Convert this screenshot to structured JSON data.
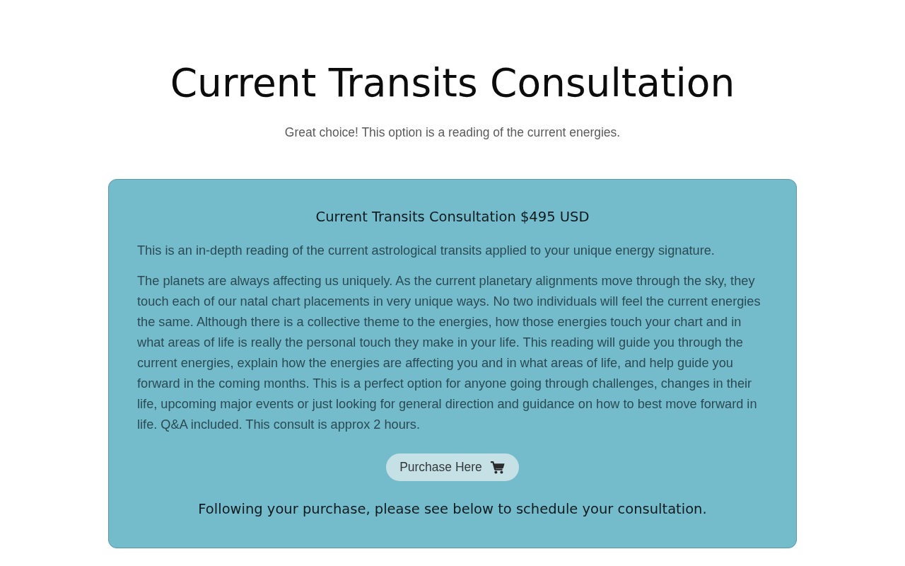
{
  "page": {
    "title": "Current Transits Consultation",
    "subtitle": "Great choice! This option is a reading of the current energies."
  },
  "card": {
    "heading": "Current Transits Consultation $495 USD",
    "paragraphs": [
      "This is an in-depth reading of the current astrological transits applied to your unique energy signature.",
      "The planets are always affecting us uniquely. As the current planetary alignments move through the sky, they touch each of our natal chart placements in very unique ways. No two individuals will feel the current energies the same. Although there is a collective theme to the energies, how those energies touch your chart and in what areas of life is really the personal touch they make in your life. This reading will guide you through the current energies, explain how the energies are affecting you and in what areas of life, and help guide you forward in the coming months. This is a perfect option for anyone going through challenges, changes in their life, upcoming major events or just looking for general direction and guidance on how to best move forward in life. Q&A included. This consult is approx 2 hours."
    ],
    "purchase_button": {
      "label": "Purchase Here"
    },
    "note": "Following your purchase, please see below to schedule your consultation."
  }
}
